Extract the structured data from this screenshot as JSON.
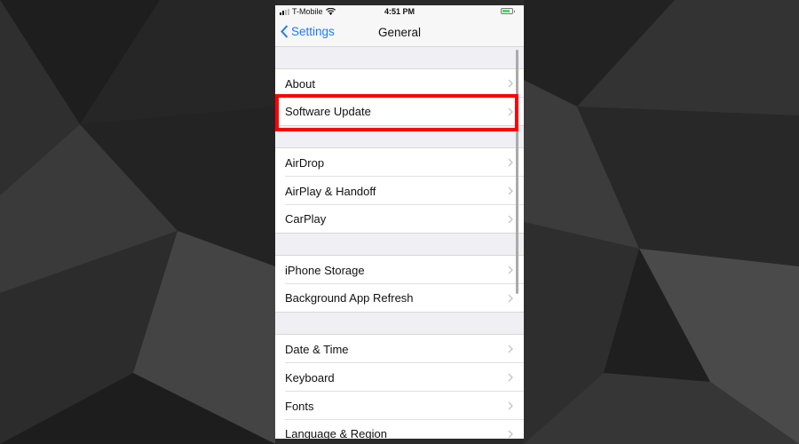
{
  "status_bar": {
    "carrier": "T-Mobile",
    "time": "4:51 PM",
    "signal_bars": 2,
    "battery": "charging"
  },
  "nav": {
    "back_label": "Settings",
    "title": "General"
  },
  "groups": [
    {
      "items": [
        {
          "label": "About"
        },
        {
          "label": "Software Update",
          "highlighted": true
        }
      ]
    },
    {
      "items": [
        {
          "label": "AirDrop"
        },
        {
          "label": "AirPlay & Handoff"
        },
        {
          "label": "CarPlay"
        }
      ]
    },
    {
      "items": [
        {
          "label": "iPhone Storage"
        },
        {
          "label": "Background App Refresh"
        }
      ]
    },
    {
      "items": [
        {
          "label": "Date & Time"
        },
        {
          "label": "Keyboard"
        },
        {
          "label": "Fonts"
        },
        {
          "label": "Language & Region"
        }
      ]
    }
  ],
  "colors": {
    "accent": "#1a7cf5",
    "highlight": "#ff0000",
    "battery": "#4cd964"
  }
}
